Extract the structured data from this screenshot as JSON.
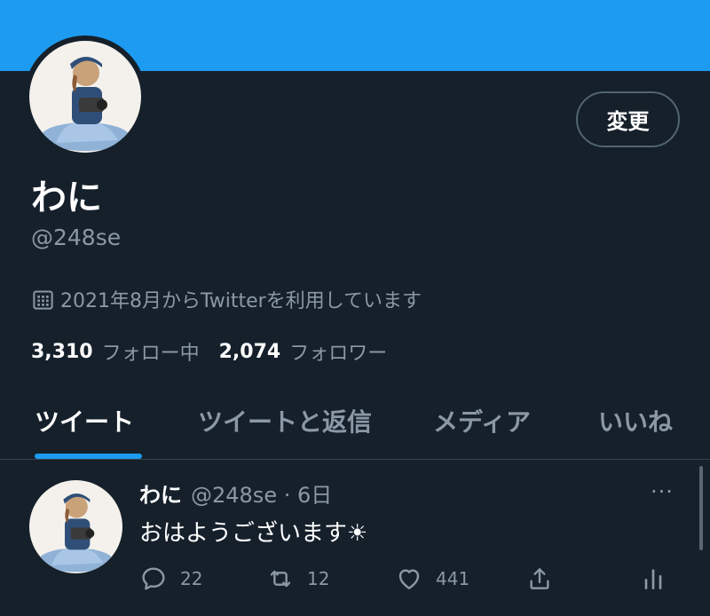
{
  "colors": {
    "accent": "#1d9bf0",
    "background": "#15202b",
    "muted": "#8b98a5",
    "border": "#536471"
  },
  "profile": {
    "edit_label": "変更",
    "display_name": "わに",
    "handle": "@248se",
    "joined": "2021年8月からTwitterを利用しています",
    "following_count": "3,310",
    "following_label": "フォロー中",
    "followers_count": "2,074",
    "followers_label": "フォロワー"
  },
  "tabs": [
    {
      "label": "ツイート",
      "active": true
    },
    {
      "label": "ツイートと返信",
      "active": false
    },
    {
      "label": "メディア",
      "active": false
    },
    {
      "label": "いいね",
      "active": false
    }
  ],
  "tweet": {
    "name": "わに",
    "handle_time": "@248se · 6日",
    "more": "···",
    "text": "おはようございます☀︎",
    "replies": "22",
    "retweets": "12",
    "likes": "441"
  },
  "icons": [
    "calendar-icon",
    "reply-icon",
    "retweet-icon",
    "like-icon",
    "share-icon",
    "analytics-icon",
    "more-icon"
  ]
}
